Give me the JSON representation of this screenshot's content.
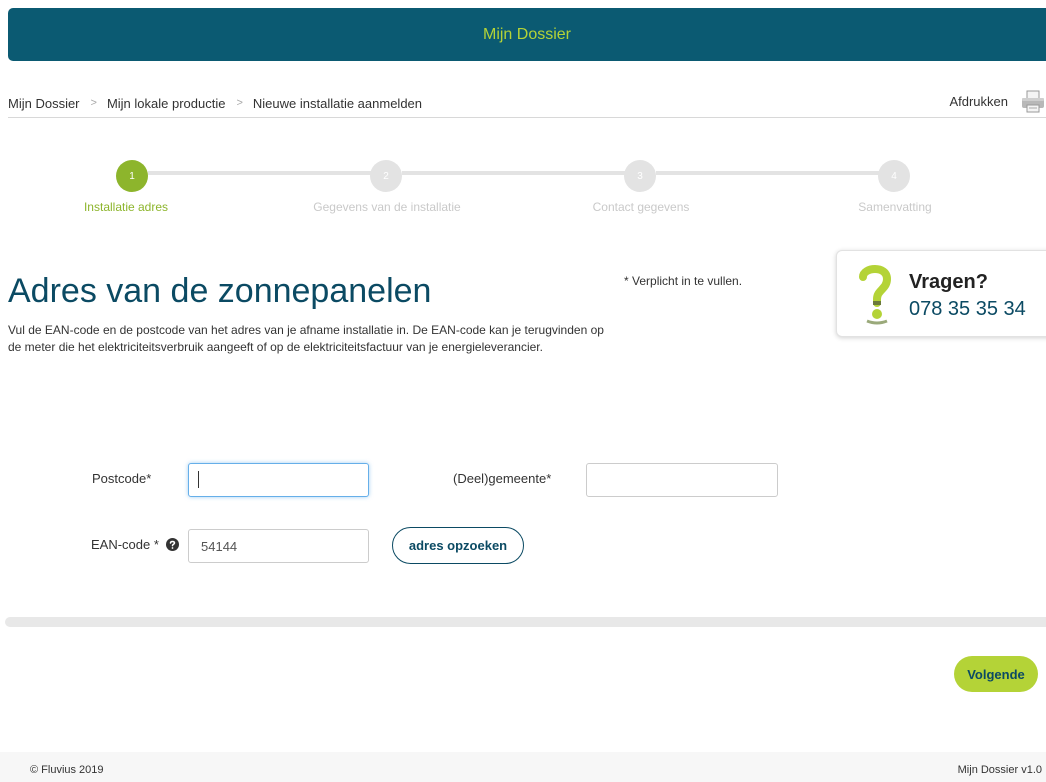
{
  "header": {
    "title": "Mijn Dossier"
  },
  "breadcrumb": {
    "items": [
      "Mijn Dossier",
      "Mijn lokale productie",
      "Nieuwe installatie aanmelden"
    ],
    "separator": ">"
  },
  "print": {
    "label": "Afdrukken",
    "icon": "printer-icon"
  },
  "stepper": {
    "steps": [
      {
        "number": "1",
        "label": "Installatie adres",
        "active": true
      },
      {
        "number": "2",
        "label": "Gegevens van de installatie",
        "active": false
      },
      {
        "number": "3",
        "label": "Contact gegevens",
        "active": false
      },
      {
        "number": "4",
        "label": "Samenvatting",
        "active": false
      }
    ]
  },
  "main": {
    "title": "Adres van de zonnepanelen",
    "required_note": "* Verplicht in te vullen.",
    "intro": "Vul de EAN-code en de postcode van het adres van je afname installatie in. De EAN-code kan je terugvinden op de meter die het elektriciteitsverbruik aangeeft of op de elektriciteitsfactuur van je energieleverancier."
  },
  "help": {
    "title": "Vragen?",
    "phone": "078 35 35 34",
    "icon": "question-mark-icon"
  },
  "form": {
    "postcode": {
      "label": "Postcode*",
      "value": ""
    },
    "gemeente": {
      "label": "(Deel)gemeente*",
      "value": ""
    },
    "ean": {
      "label": "EAN-code *",
      "value": "54144",
      "help_icon": "question-circle-icon"
    },
    "lookup_button": "adres opzoeken"
  },
  "next_button": "Volgende",
  "footer": {
    "copyright": "© Fluvius 2019",
    "version": "Mijn Dossier v1.0"
  },
  "colors": {
    "header_bg": "#0b5a72",
    "accent_green": "#b4d337",
    "step_active": "#8db52c",
    "title_blue": "#0b4a63",
    "inactive": "#e3e3e3"
  }
}
